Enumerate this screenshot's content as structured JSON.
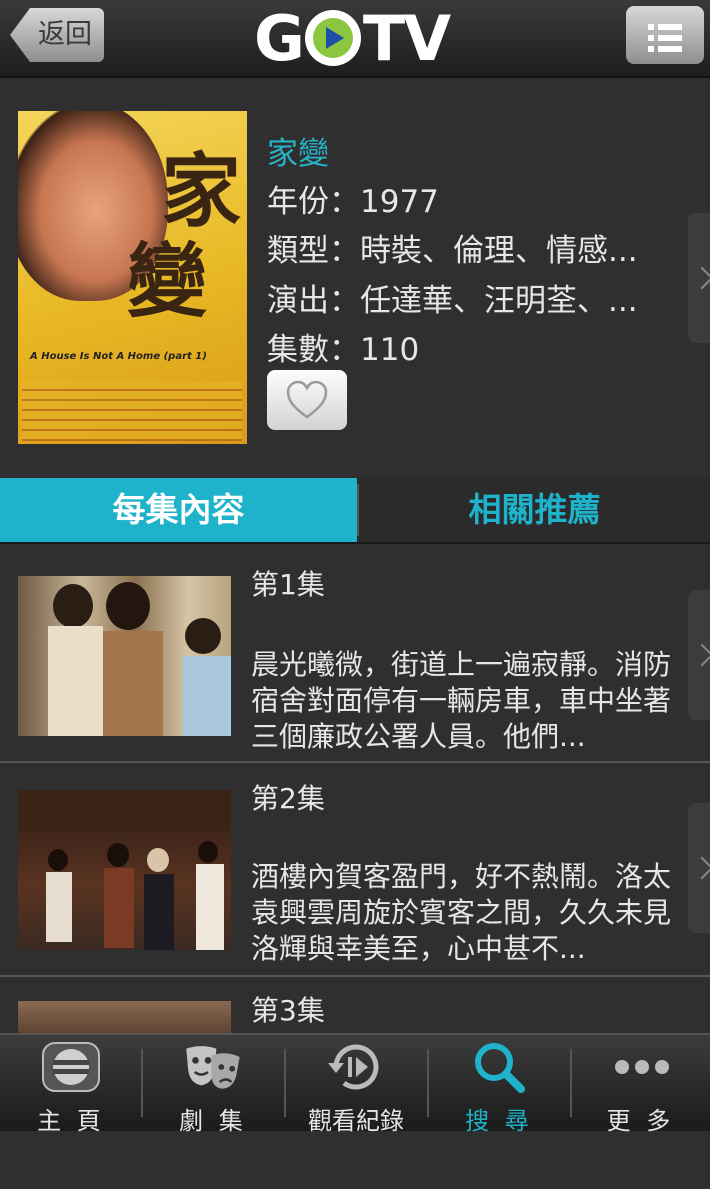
{
  "header": {
    "back_label": "返回",
    "logo_text_pre": "G",
    "logo_text_post": "TV"
  },
  "detail": {
    "title": "家變",
    "year_line": "年份：1977",
    "genre_line": "類型：時裝、倫理、情感...",
    "cast_line": "演出：任達華、汪明荃、...",
    "episodes_line": "集數：110",
    "poster": {
      "title_chars": [
        "家",
        "變"
      ],
      "english_title": "A House Is Not A Home (part 1)"
    }
  },
  "tabs": [
    {
      "label": "每集內容",
      "active": true
    },
    {
      "label": "相關推薦",
      "active": false
    }
  ],
  "episodes": [
    {
      "title": "第1集",
      "description": "晨光曦微，街道上一遍寂靜。消防宿舍對面停有一輛房車，車中坐著三個廉政公署人員。他們..."
    },
    {
      "title": "第2集",
      "description": "酒樓內賀客盈門，好不熱鬧。洛太袁興雲周旋於賓客之間，久久未見洛輝與幸美至，心中甚不..."
    },
    {
      "title": "第3集",
      "description": ""
    }
  ],
  "bottom_nav": [
    {
      "label": "主 頁",
      "icon": "home-icon",
      "active": false
    },
    {
      "label": "劇 集",
      "icon": "drama-masks-icon",
      "active": false
    },
    {
      "label": "觀看紀錄",
      "icon": "history-play-icon",
      "active": false
    },
    {
      "label": "搜 尋",
      "icon": "search-icon",
      "active": true
    },
    {
      "label": "更 多",
      "icon": "more-dots-icon",
      "active": false
    }
  ],
  "colors": {
    "accent": "#1fb3cb",
    "background": "#2f2f2f"
  }
}
